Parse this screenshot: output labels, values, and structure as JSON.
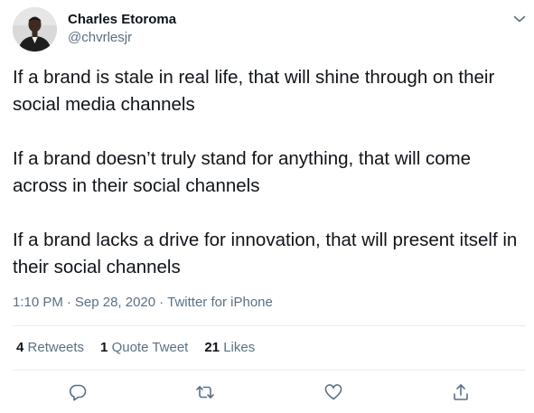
{
  "author": {
    "name": "Charles Etoroma",
    "handle": "@chvrlesjr"
  },
  "tweet": {
    "paragraphs": [
      "If a brand is stale in real life, that will shine through on their social media channels",
      "If a brand doesn’t truly stand for anything, that will come across in their social channels",
      "If a brand lacks a drive for innovation, that will present itself in their social channels"
    ],
    "time": "1:10 PM",
    "date": "Sep 28, 2020",
    "source": "Twitter for iPhone",
    "separator": "·"
  },
  "stats": {
    "retweets_count": "4",
    "retweets_label": "Retweets",
    "quotes_count": "1",
    "quotes_label": "Quote Tweet",
    "likes_count": "21",
    "likes_label": "Likes"
  },
  "icons": {
    "more": "chevron-down-icon",
    "reply": "reply-icon",
    "retweet": "retweet-icon",
    "like": "heart-icon",
    "share": "share-icon"
  },
  "colors": {
    "text": "#0f1419",
    "secondary": "#5b7083",
    "divider": "#e6ecf0",
    "icon": "#5b7083"
  }
}
